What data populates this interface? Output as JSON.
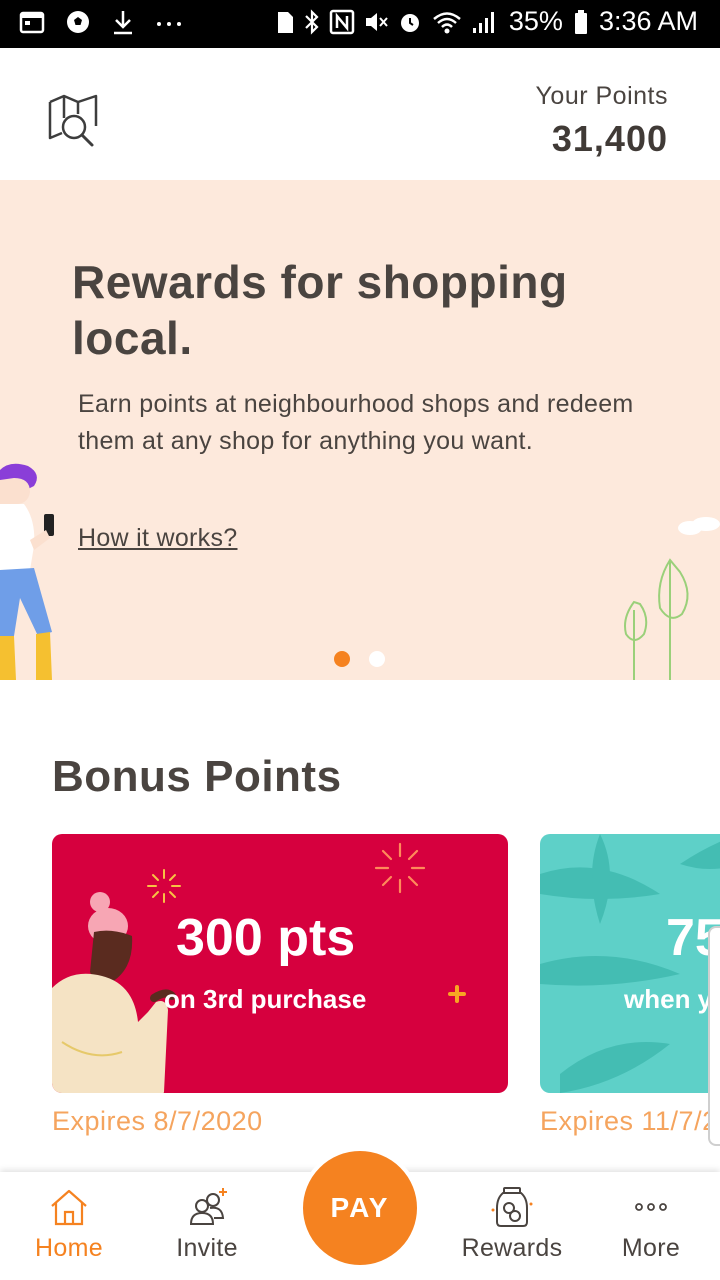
{
  "status_bar": {
    "battery": "35%",
    "time": "3:36 AM",
    "left_icons": [
      "calendar-icon",
      "soccer-ball-icon",
      "download-icon",
      "more-dots-icon"
    ],
    "right_icons": [
      "sim-icon",
      "bluetooth-icon",
      "nfc-icon",
      "mute-icon",
      "alarm-icon",
      "wifi-icon",
      "signal-icon",
      "battery-icon"
    ]
  },
  "header": {
    "points_label": "Your Points",
    "points_value": "31,400",
    "icon": "map-search-icon"
  },
  "hero": {
    "title": "Rewards for shopping local.",
    "body": "Earn points at neighbourhood shops and redeem them at any shop for anything you want.",
    "link": "How it works?",
    "slides": 2,
    "active_slide": 1
  },
  "bonus": {
    "title": "Bonus Points",
    "cards": [
      {
        "big": "300 pts",
        "small": "on 3rd purchase",
        "expires": "Expires 8/7/2020",
        "color": "#d6003e"
      },
      {
        "big": "75",
        "small": "when y",
        "expires": "Expires 11/7/2",
        "color": "#5ed0c8"
      }
    ]
  },
  "nav": {
    "home": "Home",
    "invite": "Invite",
    "pay": "PAY",
    "rewards": "Rewards",
    "more": "More"
  },
  "colors": {
    "accent": "#f58220",
    "hero_bg": "#fde9dc",
    "text": "#4a4440"
  }
}
